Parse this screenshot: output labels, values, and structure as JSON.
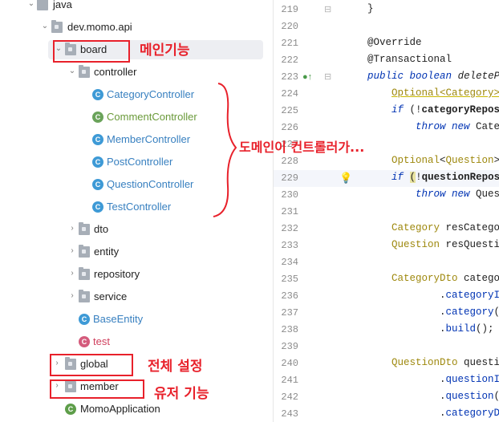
{
  "tree": {
    "java": "java",
    "package": "dev.momo.api",
    "board": "board",
    "controller": "controller",
    "controllers": [
      {
        "label": "CategoryController",
        "color": "#3880c0",
        "spring": false
      },
      {
        "label": "CommentController",
        "color": "#6a9a3a",
        "spring": true
      },
      {
        "label": "MemberController",
        "color": "#3880c0",
        "spring": false
      },
      {
        "label": "PostController",
        "color": "#3880c0",
        "spring": false
      },
      {
        "label": "QuestionController",
        "color": "#3880c0",
        "spring": false
      },
      {
        "label": "TestController",
        "color": "#3880c0",
        "spring": false
      }
    ],
    "dto": "dto",
    "entity": "entity",
    "repository": "repository",
    "service": "service",
    "base_entity": "BaseEntity",
    "test": "test",
    "global": "global",
    "member": "member",
    "app": "MomoApplication"
  },
  "annotations": {
    "main_feature": "메인기능",
    "domain_group": "도메인이 컨트롤러가...",
    "global_settings": "전체 설정",
    "user_feature": "유저 기능"
  },
  "editor": {
    "lines": [
      {
        "n": "219",
        "code": "    }"
      },
      {
        "n": "220",
        "code": ""
      },
      {
        "n": "221",
        "code": "    @Override"
      },
      {
        "n": "222",
        "code": "    @Transactional"
      },
      {
        "n": "223",
        "code": "    public boolean deletePost"
      },
      {
        "n": "224",
        "code": "        Optional<Category> ca"
      },
      {
        "n": "225",
        "code": "        if (!categoryRepositor"
      },
      {
        "n": "226",
        "code": "            throw new Category"
      },
      {
        "n": "227",
        "code": ""
      },
      {
        "n": "228",
        "code": "        Optional<Question> qu"
      },
      {
        "n": "229",
        "code": "        if (!questionReposito"
      },
      {
        "n": "230",
        "code": "            throw new Questio"
      },
      {
        "n": "231",
        "code": ""
      },
      {
        "n": "232",
        "code": "        Category resCategory"
      },
      {
        "n": "233",
        "code": "        Question resQuestion"
      },
      {
        "n": "234",
        "code": ""
      },
      {
        "n": "235",
        "code": "        CategoryDto categoryD"
      },
      {
        "n": "236",
        "code": "                .categoryId(r"
      },
      {
        "n": "237",
        "code": "                .category(res"
      },
      {
        "n": "238",
        "code": "                .build();"
      },
      {
        "n": "239",
        "code": ""
      },
      {
        "n": "240",
        "code": "        QuestionDto questionD"
      },
      {
        "n": "241",
        "code": "                .questionId(r"
      },
      {
        "n": "242",
        "code": "                .question(res"
      },
      {
        "n": "243",
        "code": "                .categoryDto("
      }
    ]
  },
  "colors": {
    "annotation_red": "#e8212b",
    "selection": "#edeef2",
    "keyword": "#0033b3"
  }
}
